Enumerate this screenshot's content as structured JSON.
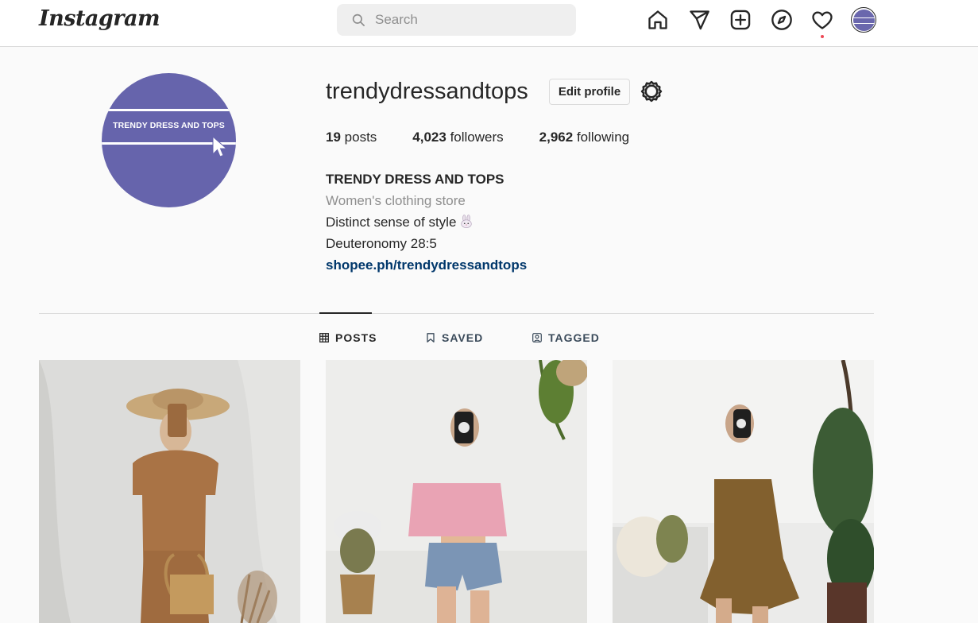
{
  "nav": {
    "logo": "Instagram",
    "search_placeholder": "Search",
    "icons": [
      "home-icon",
      "direct-message-icon",
      "new-post-icon",
      "explore-icon",
      "activity-heart-icon",
      "profile-avatar"
    ]
  },
  "profile": {
    "avatar_text": "TRENDY DRESS AND TOPS",
    "username": "trendydressandtops",
    "edit_label": "Edit profile",
    "stats": {
      "posts_count": "19",
      "posts_label": "posts",
      "followers_count": "4,023",
      "followers_label": "followers",
      "following_count": "2,962",
      "following_label": "following"
    },
    "bio": {
      "name": "TRENDY DRESS AND TOPS",
      "category": "Women's clothing store",
      "line1": "Distinct sense of style",
      "line2": "Deuteronomy 28:5",
      "link": "shopee.ph/trendydressandtops"
    }
  },
  "tabs": [
    {
      "label": "POSTS",
      "icon": "grid-icon",
      "active": true
    },
    {
      "label": "SAVED",
      "icon": "bookmark-icon",
      "active": false
    },
    {
      "label": "TAGGED",
      "icon": "tagged-icon",
      "active": false
    }
  ],
  "posts": [
    {
      "description": "woman in brown ribbed top and shorts with straw hat and woven bag"
    },
    {
      "description": "woman in pink tube top and denim shorts"
    },
    {
      "description": "woman in brown strappy mini dress"
    }
  ],
  "colors": {
    "accent_avatar": "#6664ac",
    "link": "#00376b",
    "notification_dot": "#ed4956",
    "secondary_text": "#8e8e8e",
    "border": "#dbdbdb"
  }
}
